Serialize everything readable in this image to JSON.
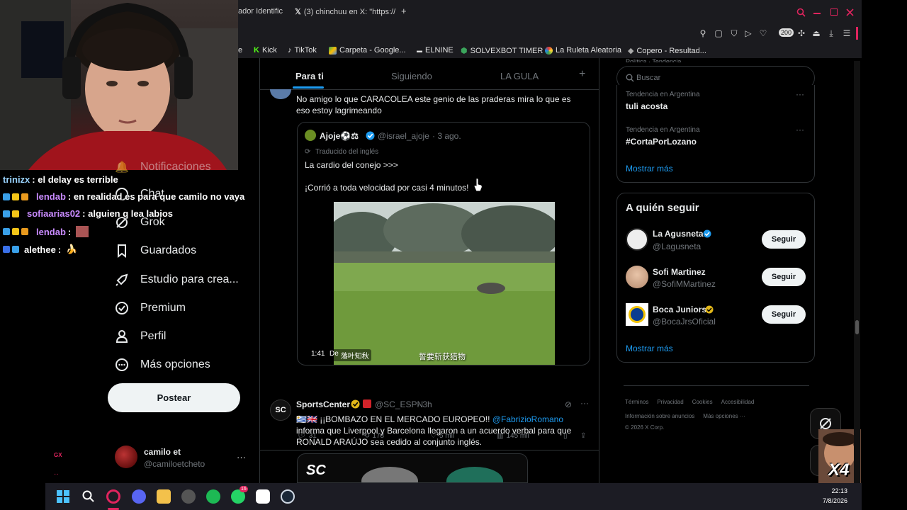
{
  "browser": {
    "tabs": [
      "ador Identific",
      "(3) chinchuu en X: \"https://",
      "+"
    ],
    "bookmarks": [
      "e",
      "Kick",
      "TikTok",
      "Carpeta - Google...",
      "ELNINE",
      "SOLVEXBOT TIMER",
      "La Ruleta Aleatoria",
      "Copero - Resultad..."
    ],
    "badge_count": "200"
  },
  "chat": [
    {
      "user": "trinizx",
      "msg": ": el delay es terrible"
    },
    {
      "user": "lendab",
      "msg": ": en realidad es para que camilo no vaya"
    },
    {
      "user": "sofiaarias02",
      "msg": ": alguien q lea labios"
    },
    {
      "user": "lendab",
      "msg": ":"
    },
    {
      "user": "alethee",
      "msg": ":"
    }
  ],
  "nav": {
    "hidden_notif": "Notificaciones",
    "chat": "Chat",
    "grok": "Grok",
    "saved": "Guardados",
    "studio": "Estudio para crea...",
    "premium": "Premium",
    "profile": "Perfil",
    "more": "Más opciones",
    "post_button": "Postear",
    "account_name": "camilo et",
    "account_handle": "@camiloetcheto",
    "mark": "GX"
  },
  "timeline": {
    "tabs": [
      "Para ti",
      "Siguiendo",
      "LA GULA"
    ],
    "plus": "+",
    "post1": {
      "text": "No amigo lo que CARACOLEA este genio de las praderas mira lo que es eso estoy lagrimeando",
      "quote": {
        "name": "Ajoje⚽⚖",
        "handle": "@israel_ajoje",
        "time": "· 3 ago.",
        "translated": "Traducido del inglés",
        "line1": "La cardio del conejo >>>",
        "line2": "¡Corrió a toda velocidad por casi 4 minutos!",
        "video_time": "1:41",
        "video_from": "De",
        "video_source": "落叶知秋",
        "video_caption": "誓要斩获猎物"
      },
      "replies": "31",
      "reposts": "178",
      "likes": "5 mil",
      "views": "145 mil"
    },
    "post2": {
      "name": "SportsCenter",
      "handle": "@SC_ESPN",
      "time": "· 3h",
      "text_prefix": "🇺🇾🇬🇧 ¡¡BOMBAZO EN EL MERCADO EUROPEO!!",
      "mention": "@FabrizioRomano",
      "text_suffix": "informa que Liverpool y Barcelona llegaron a un acuerdo verbal para que RONALD ARAÚJO sea cedido al conjunto inglés.",
      "logo": "SC"
    }
  },
  "right": {
    "search_placeholder": "Buscar",
    "partial_trend": "Política · Tendencia",
    "trends": [
      {
        "context": "Tendencia en Argentina",
        "name": "tuli acosta"
      },
      {
        "context": "Tendencia en Argentina",
        "name": "#CortaPorLozano"
      }
    ],
    "show_more": "Mostrar más",
    "who_title": "A quién seguir",
    "follow": [
      {
        "name": "La Agusneta",
        "handle": "@Lagusneta"
      },
      {
        "name": "Sofi Martinez",
        "handle": "@SofiMMartinez"
      },
      {
        "name": "Boca Juniors",
        "handle": "@BocaJrsOficial"
      }
    ],
    "follow_label": "Seguir",
    "show_more2": "Mostrar más",
    "footer1": [
      "Términos",
      "Privacidad",
      "Cookies",
      "Accesibilidad"
    ],
    "footer2": [
      "Información sobre anuncios",
      "Más opciones ···"
    ],
    "copyright": "© 2026 X Corp.",
    "overlay_text": "X4"
  },
  "taskbar": {
    "time": "22:13",
    "date": "7/8/2026",
    "whatsapp_badge": "16"
  }
}
